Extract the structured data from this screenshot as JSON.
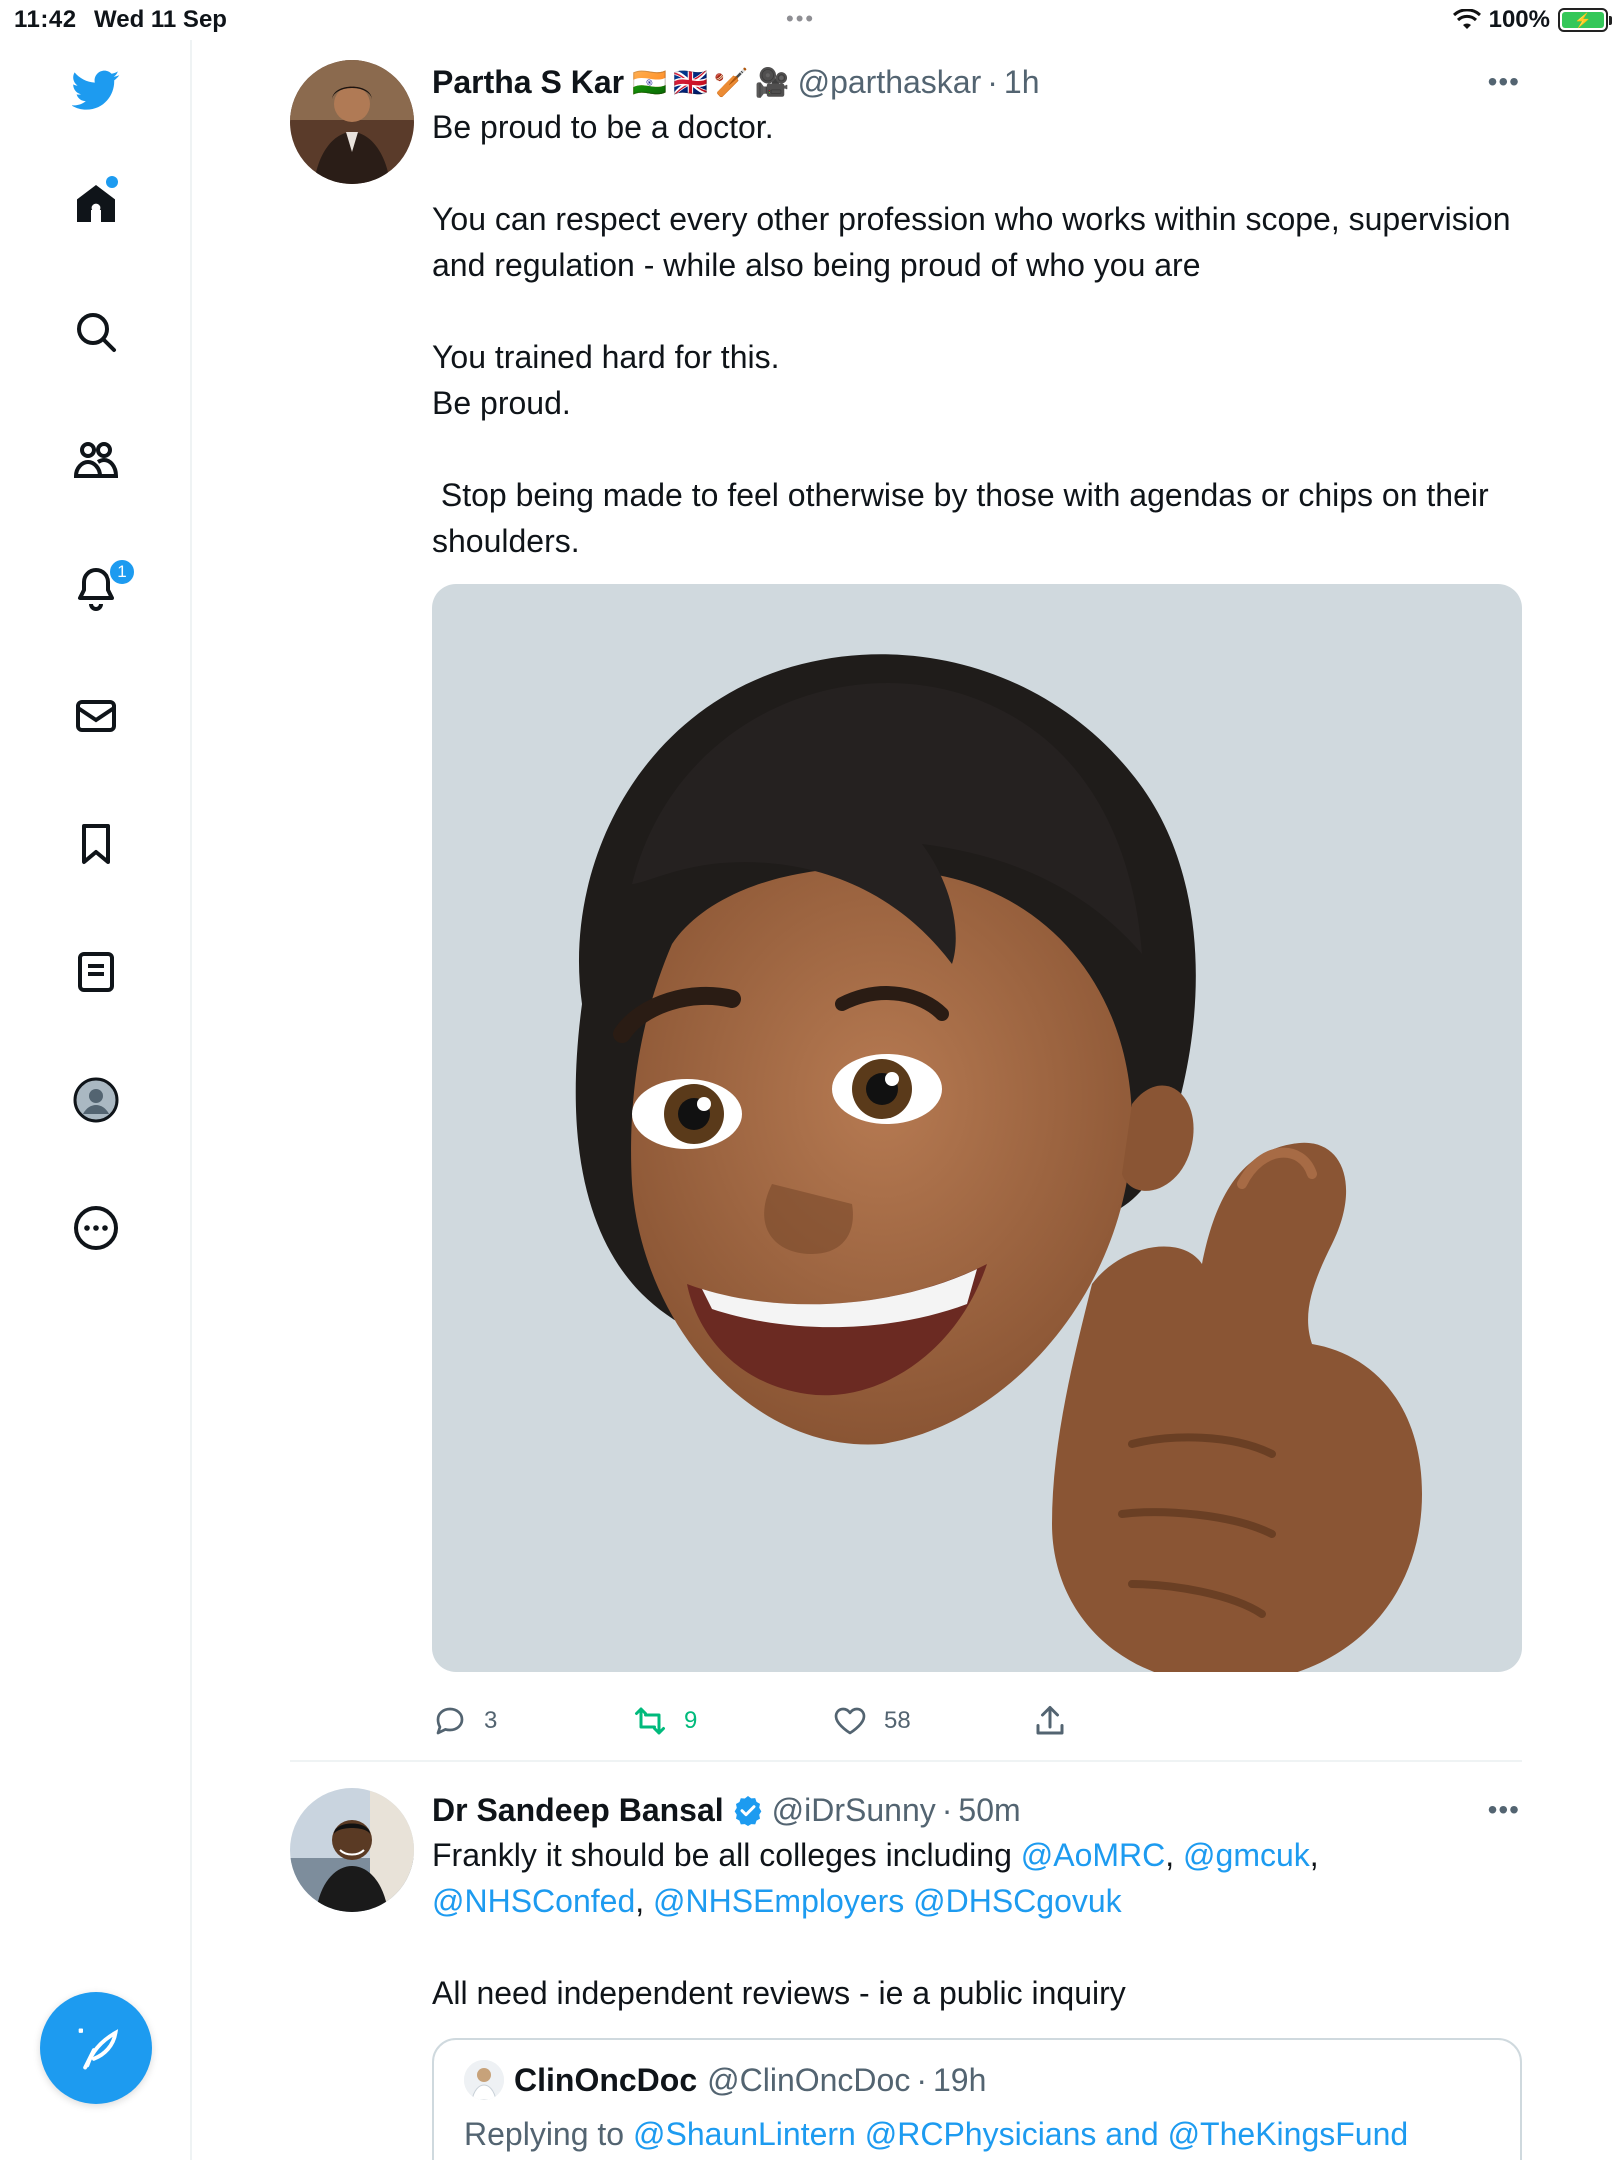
{
  "status_bar": {
    "time": "11:42",
    "date": "Wed 11 Sep",
    "battery": "100%"
  },
  "sidebar": {
    "icons": [
      "twitter-logo",
      "home-icon",
      "search-icon",
      "communities-icon",
      "notifications-icon",
      "messages-icon",
      "bookmarks-icon",
      "lists-icon",
      "profile-icon",
      "more-icon"
    ],
    "notifications_badge": "1"
  },
  "tweets": [
    {
      "name": "Partha S Kar",
      "flags": [
        "🇮🇳",
        "🇬🇧",
        "🏏",
        "🎥"
      ],
      "handle": "@parthaskar",
      "time": "1h",
      "text": "Be proud to be a doctor.\n\nYou can respect every other profession who works within scope, supervision and regulation - while also being proud of who you are\n\nYou trained hard for this.\nBe proud.\n\n Stop being made to feel otherwise by those with agendas or chips on their shoulders.",
      "replies": "3",
      "retweets": "9",
      "likes": "58"
    },
    {
      "name": "Dr Sandeep Bansal",
      "handle": "@iDrSunny",
      "time": "50m",
      "text_line1_a": "Frankly it should be all colleges including ",
      "mention_1": "@AoMRC",
      "comma_1": ", ",
      "mention_2": "@gmcuk",
      "comma_2": ",",
      "mention_3": "@NHSConfed",
      "comma_3": ", ",
      "mention_4": "@NHSEmployers",
      "space_4": " ",
      "mention_5": "@DHSCgovuk",
      "text_para2": "All need independent reviews - ie a public inquiry",
      "quote": {
        "name": "ClinOncDoc",
        "handle": "@ClinOncDoc",
        "time": "19h",
        "replying_prefix": "Replying to ",
        "replying_to": "@ShaunLintern @RCPhysicians and @TheKingsFund"
      }
    }
  ],
  "colors": {
    "accent": "#1d9bf0",
    "retweet": "#00ba7c",
    "secondary_text": "#536471",
    "media_bg": "#d0d9de"
  }
}
